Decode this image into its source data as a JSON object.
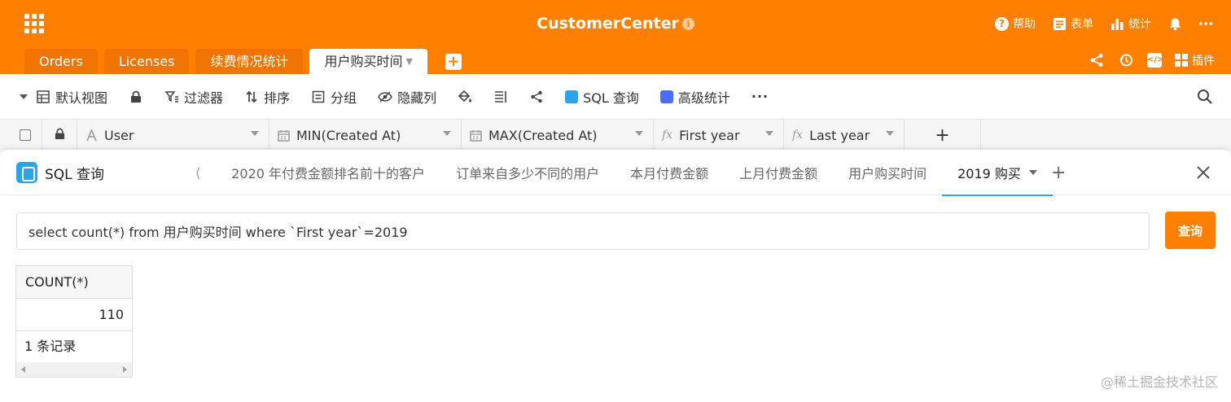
{
  "header": {
    "title": "CustomerCenter",
    "info_icon": "info-icon",
    "help_label": "帮助",
    "form_label": "表单",
    "stats_label": "统计",
    "plugins_label": "插件"
  },
  "tabs": [
    {
      "label": "Orders"
    },
    {
      "label": "Licenses"
    },
    {
      "label": "续费情况统计"
    },
    {
      "label": "用户购买时间",
      "active": true
    }
  ],
  "toolbar": {
    "view_label": "默认视图",
    "filter_label": "过滤器",
    "sort_label": "排序",
    "group_label": "分组",
    "hide_label": "隐藏列",
    "sql_label": "SQL 查询",
    "advanced_stats_label": "高级统计",
    "more_label": "···"
  },
  "columns": [
    {
      "name": "User",
      "icon": "text-icon"
    },
    {
      "name": "MIN(Created At)",
      "icon": "calendar-icon"
    },
    {
      "name": "MAX(Created At)",
      "icon": "calendar-icon"
    },
    {
      "name": "First year",
      "icon": "formula-icon"
    },
    {
      "name": "Last year",
      "icon": "formula-icon"
    }
  ],
  "column_add_label": "+",
  "sql_panel": {
    "title": "SQL 查询",
    "tabs_overflow": "⟨",
    "query_tabs": [
      "2020 年付费金额排名前十的客户",
      "订单来自多少不同的用户",
      "本月付费金额",
      "上月付费金额",
      "用户购买时间",
      "2019 购买"
    ],
    "active_tab_index": 5,
    "add_tab_label": "+",
    "query_text": "select count(*) from 用户购买时间 where `First year`=2019",
    "query_button_label": "查询",
    "result": {
      "column": "COUNT(*)",
      "value": "110",
      "record_count": "1 条记录"
    }
  },
  "watermark": "@稀土掘金技术社区",
  "colors": {
    "brand": "#ff8000",
    "accent_blue": "#2ba4e9"
  }
}
